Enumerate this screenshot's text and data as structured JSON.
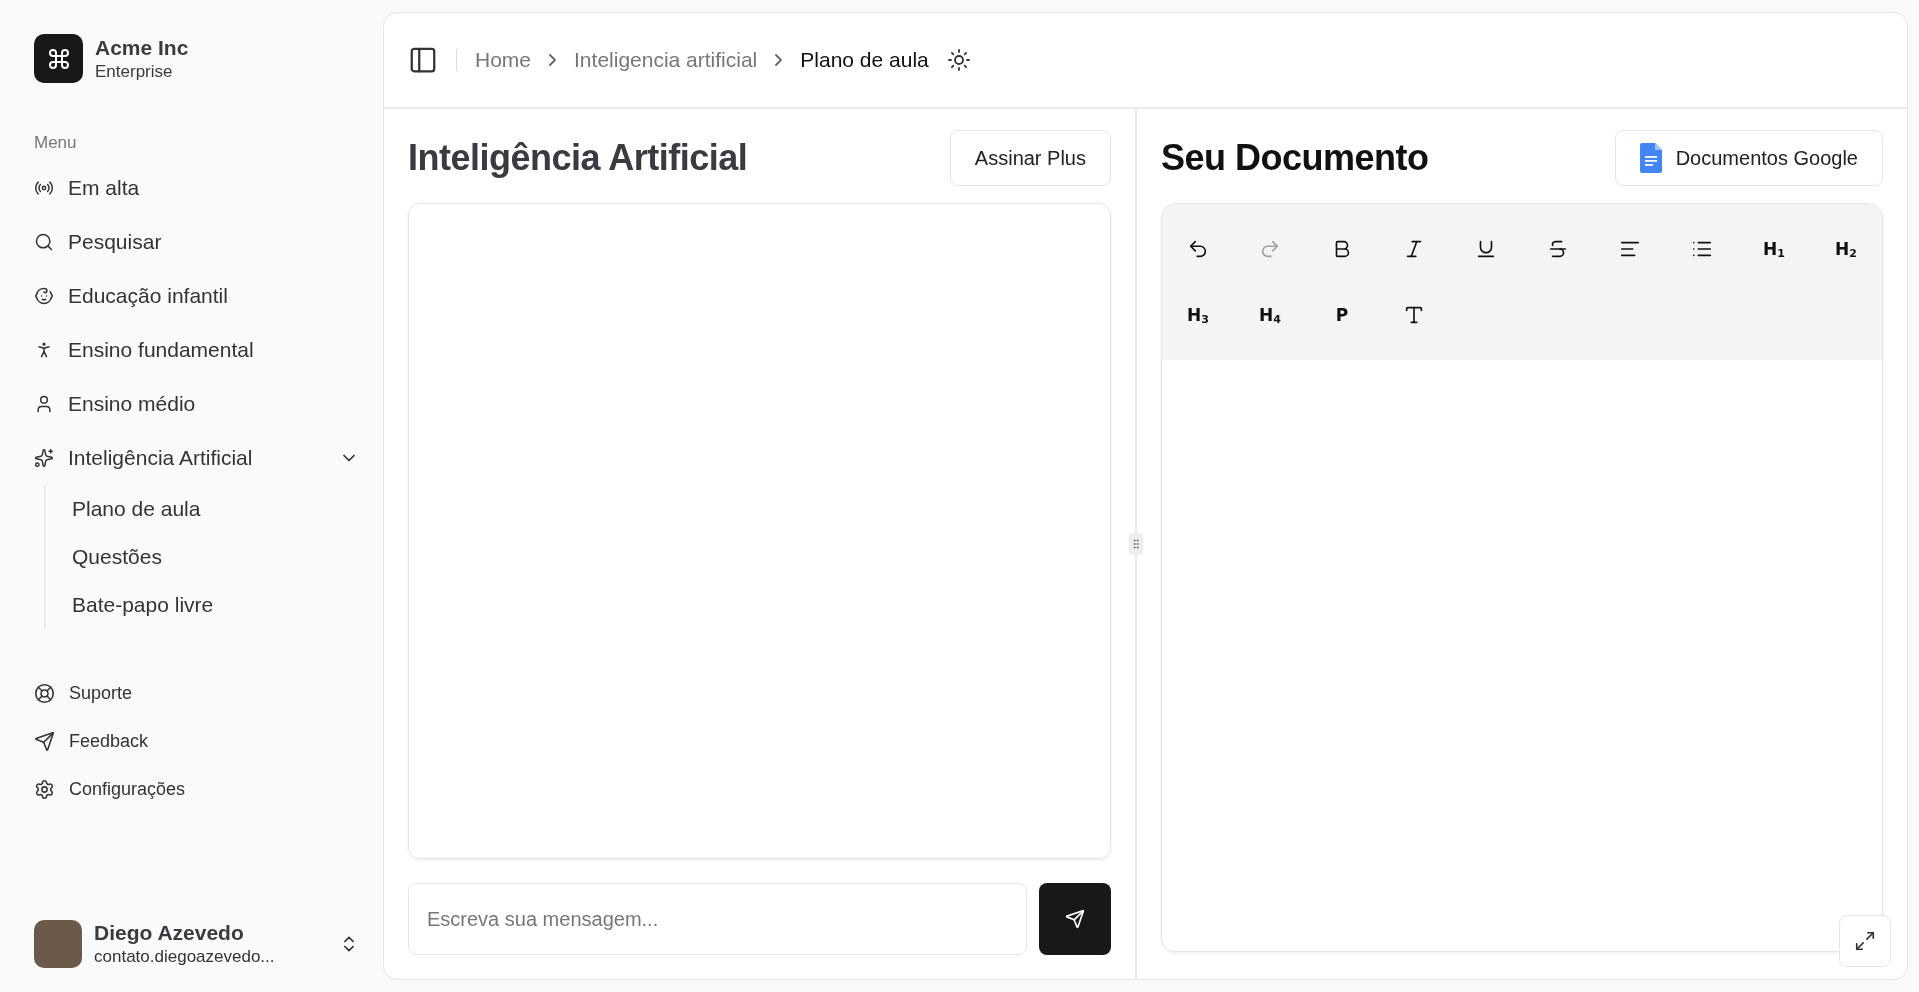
{
  "team": {
    "name": "Acme Inc",
    "plan": "Enterprise"
  },
  "sidebar": {
    "section_label": "Menu",
    "items": [
      {
        "label": "Em alta"
      },
      {
        "label": "Pesquisar"
      },
      {
        "label": "Educação infantil"
      },
      {
        "label": "Ensino fundamental"
      },
      {
        "label": "Ensino médio"
      },
      {
        "label": "Inteligência Artificial",
        "expanded": true,
        "children": [
          {
            "label": "Plano de aula"
          },
          {
            "label": "Questões"
          },
          {
            "label": "Bate-papo livre"
          }
        ]
      }
    ],
    "secondary_items": [
      {
        "label": "Suporte"
      },
      {
        "label": "Feedback"
      },
      {
        "label": "Configurações"
      }
    ]
  },
  "user": {
    "name": "Diego Azevedo",
    "email": "contato.diegoazevedo..."
  },
  "breadcrumb": [
    {
      "label": "Home",
      "current": false
    },
    {
      "label": "Inteligencia artificial",
      "current": false
    },
    {
      "label": "Plano de aula",
      "current": true
    }
  ],
  "chat": {
    "title": "Inteligência Artificial",
    "button": "Assinar Plus",
    "input_placeholder": "Escreva sua mensagem..."
  },
  "document": {
    "title": "Seu Documento",
    "button": "Documentos Google",
    "toolbar": [
      {
        "kind": "icon",
        "disabled": false
      },
      {
        "kind": "icon",
        "disabled": true
      },
      {
        "kind": "icon",
        "disabled": false
      },
      {
        "kind": "icon",
        "disabled": false
      },
      {
        "kind": "icon",
        "disabled": false
      },
      {
        "kind": "icon",
        "disabled": false
      },
      {
        "kind": "icon",
        "disabled": false
      },
      {
        "kind": "icon",
        "disabled": false
      },
      {
        "kind": "text",
        "label": "H$_{1}$",
        "disabled": false
      },
      {
        "kind": "text",
        "label": "H$_{2}$",
        "disabled": false
      },
      {
        "kind": "text",
        "label": "H$_{3}$",
        "disabled": false
      },
      {
        "kind": "text",
        "label": "H$_{4}$",
        "disabled": false
      },
      {
        "kind": "text",
        "label": "P",
        "disabled": false
      },
      {
        "kind": "icon",
        "disabled": false
      }
    ]
  }
}
